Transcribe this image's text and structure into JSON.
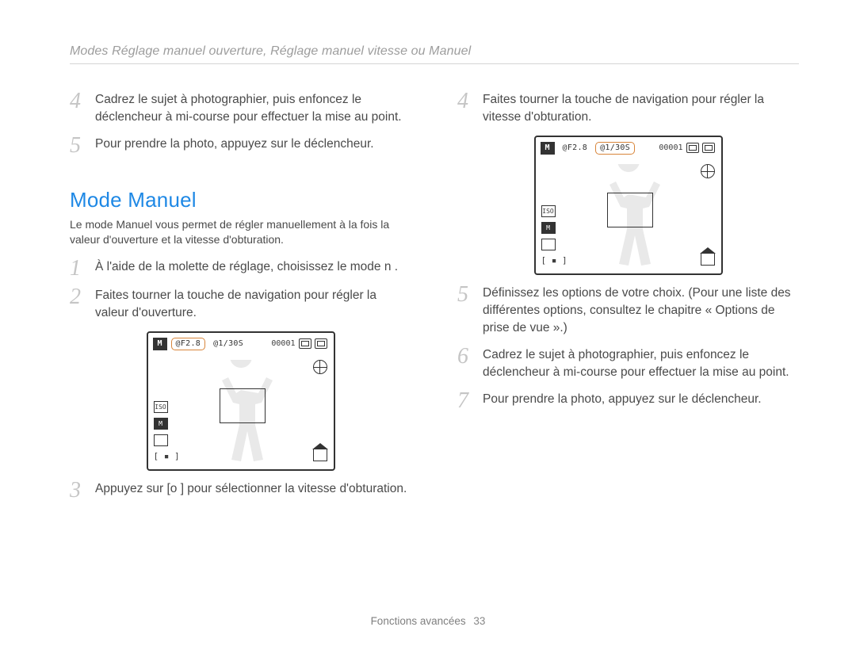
{
  "header": {
    "title": "Modes Réglage manuel ouverture, Réglage manuel vitesse ou Manuel"
  },
  "section": {
    "title": "Mode Manuel",
    "intro": "Le mode Manuel vous permet de régler manuellement à la fois la valeur d'ouverture et la vitesse d'obturation."
  },
  "left_pre_steps": [
    {
      "num": "4",
      "text": "Cadrez le sujet à photographier, puis enfoncez le déclencheur à mi-course pour effectuer la mise au point."
    },
    {
      "num": "5",
      "text": "Pour prendre la photo, appuyez sur le déclencheur."
    }
  ],
  "left_steps": [
    {
      "num": "1",
      "text": "À l'aide de la molette de réglage, choisissez le mode n ."
    },
    {
      "num": "2",
      "text": "Faites tourner la touche de navigation pour régler la valeur d'ouverture."
    }
  ],
  "left_post_steps": [
    {
      "num": "3",
      "text": "Appuyez sur [o    ] pour sélectionner la vitesse d'obturation."
    }
  ],
  "right_steps_a": [
    {
      "num": "4",
      "text": "Faites tourner la touche de navigation pour régler la vitesse d'obturation."
    }
  ],
  "right_steps_b": [
    {
      "num": "5",
      "text": "Définissez les options de votre choix. (Pour une liste des différentes options, consultez le chapitre « Options de prise de vue ».)"
    },
    {
      "num": "6",
      "text": "Cadrez le sujet à photographier, puis enfoncez le déclencheur à mi-course pour effectuer la mise au point."
    },
    {
      "num": "7",
      "text": "Pour prendre la photo, appuyez sur le déclencheur."
    }
  ],
  "screen_left": {
    "mode": "M",
    "aperture": "@F2.8",
    "shutter": "@1/30S",
    "shots_remaining": "00001",
    "selected": "aperture"
  },
  "screen_right": {
    "mode": "M",
    "aperture": "@F2.8",
    "shutter": "@1/30S",
    "shots_remaining": "00001",
    "selected": "shutter"
  },
  "icons": {
    "mode_badge": "mode-badge-icon",
    "memory_card": "memory-card-icon",
    "battery": "battery-icon",
    "globe": "flash-mode-icon",
    "home": "mode-dial-icon",
    "iso": "ISO",
    "size": "M",
    "metering": "metering-icon",
    "af_area": "af-area-icon"
  },
  "footer": {
    "section": "Fonctions avancées",
    "page": "33"
  }
}
